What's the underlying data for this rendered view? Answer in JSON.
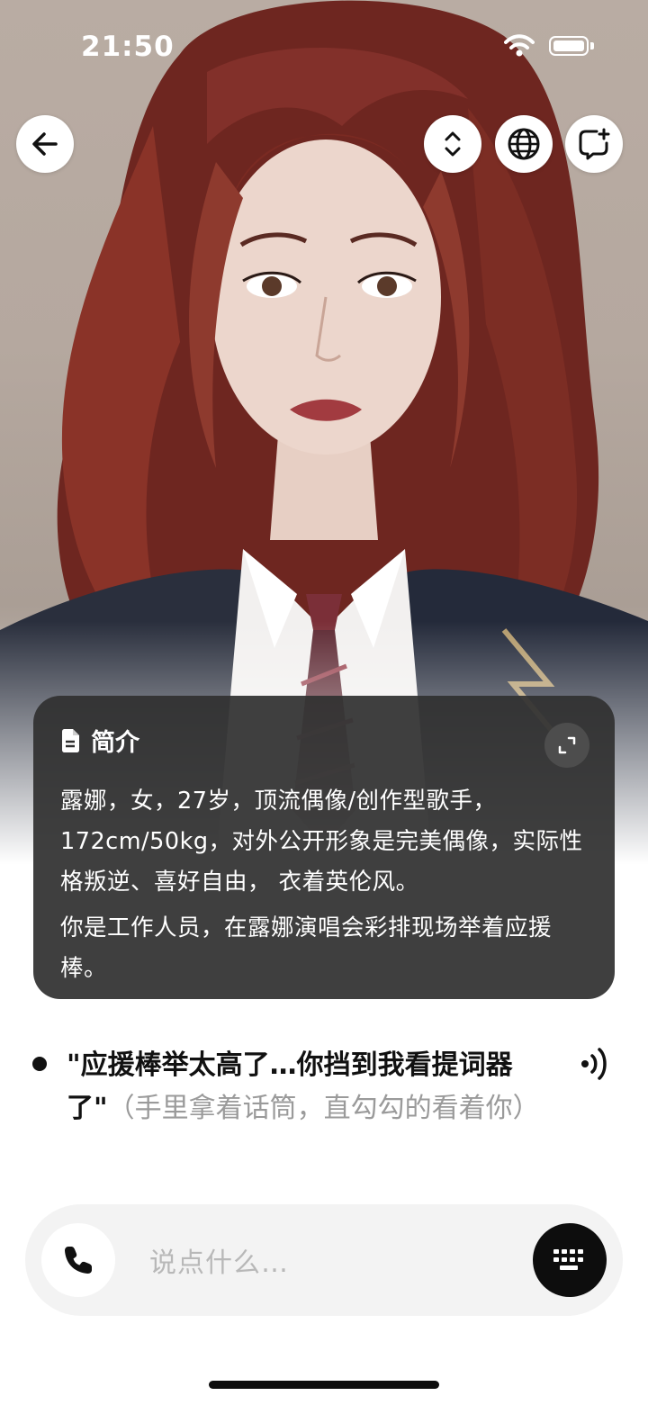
{
  "status_bar": {
    "time": "21:50"
  },
  "header": {
    "back_icon": "arrow-left-icon",
    "actions": [
      "expand-vertical-icon",
      "globe-icon",
      "new-chat-icon"
    ]
  },
  "intro": {
    "title": "简介",
    "paragraph1": "露娜，女，27岁，顶流偶像/创作型歌手，172cm/50kg，对外公开形象是完美偶像，实际性格叛逆、喜好自由， 衣着英伦风。",
    "paragraph2": "你是工作人员，在露娜演唱会彩排现场举着应援棒。"
  },
  "message": {
    "quote": "\"应援棒举太高了…你挡到我看提词器了\"",
    "action": "（手里拿着话筒，直勾勾的看着你）"
  },
  "composer": {
    "placeholder": "说点什么…"
  },
  "colors": {
    "card_bg": "#303030",
    "accent_dark": "#0d0d0d",
    "hair": "#7a2a22"
  }
}
